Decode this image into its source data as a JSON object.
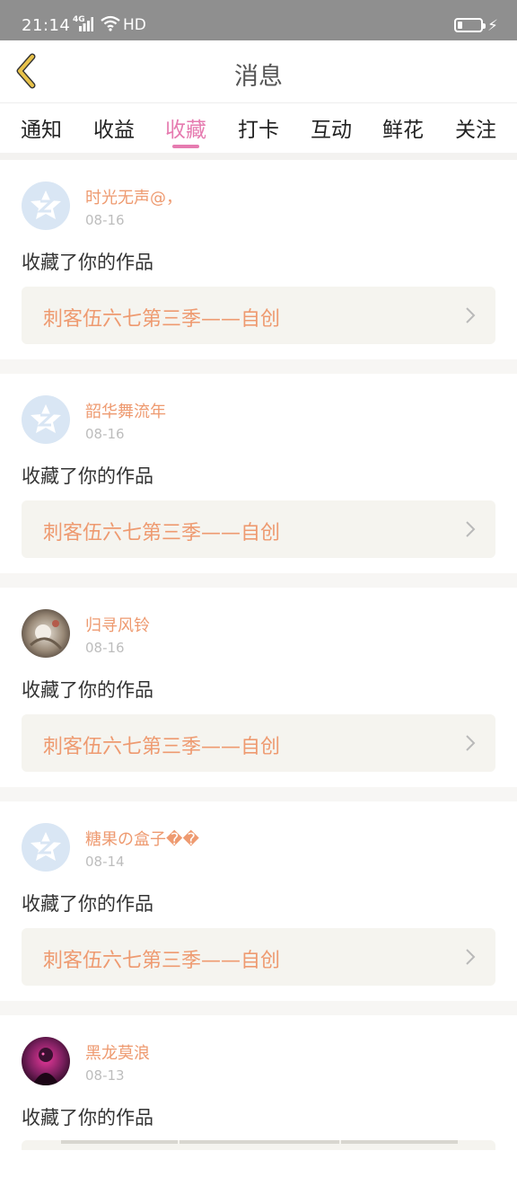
{
  "status_bar": {
    "time": "21:14",
    "signal": "4G",
    "hd": "HD"
  },
  "header": {
    "title": "消息"
  },
  "tabs": [
    {
      "label": "通知"
    },
    {
      "label": "收益"
    },
    {
      "label": "收藏",
      "active": true
    },
    {
      "label": "打卡"
    },
    {
      "label": "互动"
    },
    {
      "label": "鲜花"
    },
    {
      "label": "关注"
    }
  ],
  "colors": {
    "accent_pink": "#e67bb0",
    "name_orange": "#ee9a70",
    "back_arrow": "#e8c24a"
  },
  "notifications": [
    {
      "user": "时光无声@，",
      "date": "08-16",
      "action": "收藏了你的作品",
      "work": "刺客伍六七第三季——自创",
      "avatar": "default-avatar-icon"
    },
    {
      "user": "韶华舞流年",
      "date": "08-16",
      "action": "收藏了你的作品",
      "work": "刺客伍六七第三季——自创",
      "avatar": "default-avatar-icon"
    },
    {
      "user": "归寻风铃",
      "date": "08-16",
      "action": "收藏了你的作品",
      "work": "刺客伍六七第三季——自创",
      "avatar": "photo-avatar"
    },
    {
      "user": "糖果の盒子��",
      "date": "08-14",
      "action": "收藏了你的作品",
      "work": "刺客伍六七第三季——自创",
      "avatar": "default-avatar-icon"
    },
    {
      "user": "黑龙莫浪",
      "date": "08-13",
      "action": "收藏了你的作品",
      "work": "",
      "avatar": "photo-avatar"
    }
  ]
}
